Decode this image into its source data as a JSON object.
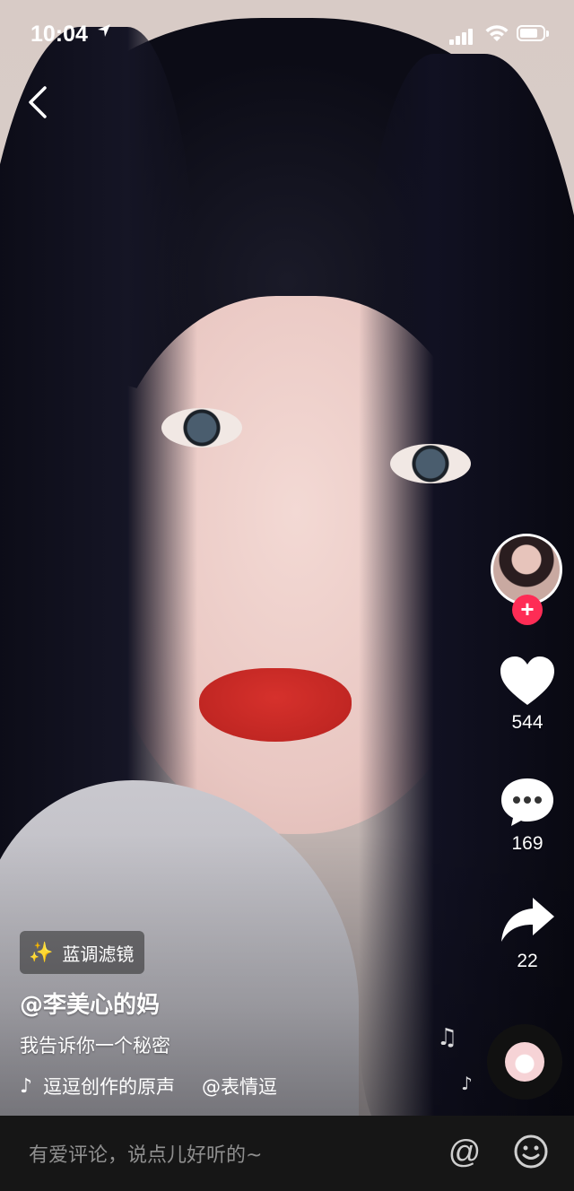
{
  "status": {
    "time": "10:04",
    "battery_level": 0.8
  },
  "icons": {
    "back": "chevron-left-icon",
    "location": "location-arrow-icon",
    "signal": "cellular-signal-icon",
    "wifi": "wifi-icon",
    "battery": "battery-icon",
    "follow": "plus-icon",
    "like": "heart-icon",
    "comment": "comment-bubble-icon",
    "share": "share-arrow-icon",
    "tiktok": "tiktok-logo-icon",
    "filter": "sparkle-wand-icon",
    "mention": "at-icon",
    "emoji": "smiley-icon"
  },
  "colors": {
    "follow_red": "#fe2c55",
    "filter_icon": "#ffcf2e",
    "comment_bar_bg": "#161616"
  },
  "actions": {
    "follow_label": "+",
    "likes": "544",
    "comments": "169",
    "shares": "22"
  },
  "post": {
    "filter_label": "蓝调滤镜",
    "author": "@李美心的妈",
    "description": "我告诉你一个秘密",
    "music_text_a": "逗逗创作的原声",
    "music_text_b": "@表情逗"
  },
  "comment_bar": {
    "placeholder": "有爱评论，说点儿好听的~",
    "at_label": "@"
  }
}
